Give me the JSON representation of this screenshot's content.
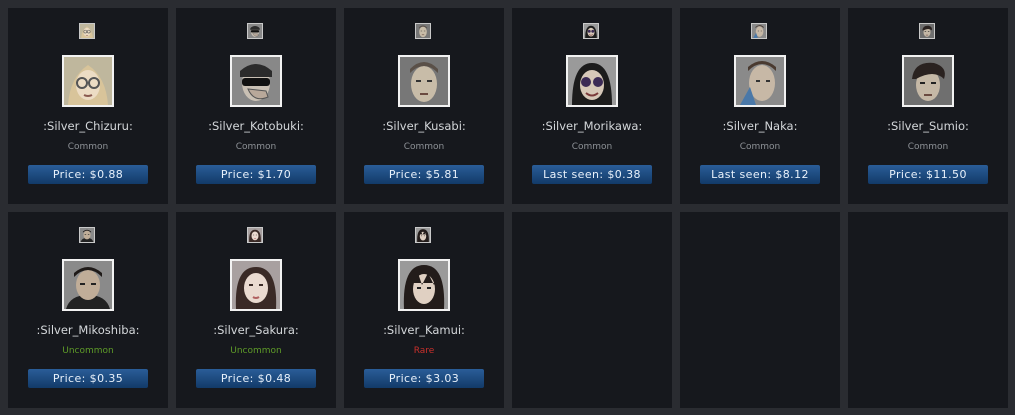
{
  "items": [
    {
      "name": ":Silver_Chizuru:",
      "rarity": "Common",
      "price": "Price: $0.88",
      "icon": "chizuru-emote-icon"
    },
    {
      "name": ":Silver_Kotobuki:",
      "rarity": "Common",
      "price": "Price: $1.70",
      "icon": "kotobuki-emote-icon"
    },
    {
      "name": ":Silver_Kusabi:",
      "rarity": "Common",
      "price": "Price: $5.81",
      "icon": "kusabi-emote-icon"
    },
    {
      "name": ":Silver_Morikawa:",
      "rarity": "Common",
      "price": "Last seen: $0.38",
      "icon": "morikawa-emote-icon"
    },
    {
      "name": ":Silver_Naka:",
      "rarity": "Common",
      "price": "Last seen: $8.12",
      "icon": "naka-emote-icon"
    },
    {
      "name": ":Silver_Sumio:",
      "rarity": "Common",
      "price": "Price: $11.50",
      "icon": "sumio-emote-icon"
    },
    {
      "name": ":Silver_Mikoshiba:",
      "rarity": "Uncommon",
      "price": "Price: $0.35",
      "icon": "mikoshiba-emote-icon"
    },
    {
      "name": ":Silver_Sakura:",
      "rarity": "Uncommon",
      "price": "Price: $0.48",
      "icon": "sakura-emote-icon"
    },
    {
      "name": ":Silver_Kamui:",
      "rarity": "Rare",
      "price": "Price: $3.03",
      "icon": "kamui-emote-icon"
    }
  ],
  "colors": {
    "background": "#2a2c31",
    "card": "#16181d",
    "uncommon": "#5e9b28",
    "rare": "#c9302c",
    "price_button": "#1f4f85"
  }
}
